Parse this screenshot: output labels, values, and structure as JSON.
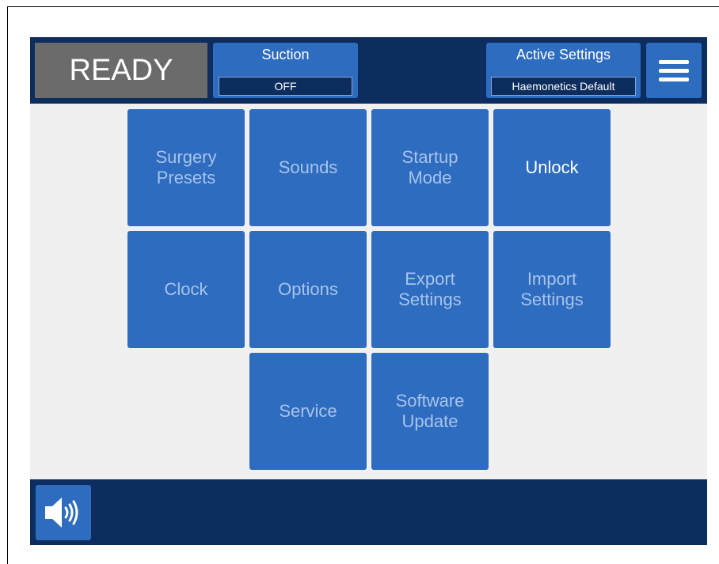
{
  "header": {
    "status": "READY",
    "suction": {
      "title": "Suction",
      "value": "OFF"
    },
    "active_settings": {
      "title": "Active Settings",
      "value": "Haemonetics Default"
    },
    "menu_icon": "hamburger-menu-icon"
  },
  "tiles": [
    {
      "label": "Surgery\nPresets",
      "enabled": false
    },
    {
      "label": "Sounds",
      "enabled": false
    },
    {
      "label": "Startup\nMode",
      "enabled": false
    },
    {
      "label": "Unlock",
      "enabled": true
    },
    {
      "label": "Clock",
      "enabled": false
    },
    {
      "label": "Options",
      "enabled": false
    },
    {
      "label": "Export\nSettings",
      "enabled": false
    },
    {
      "label": "Import\nSettings",
      "enabled": false
    },
    {
      "label": "Service",
      "enabled": false
    },
    {
      "label": "Software\nUpdate",
      "enabled": false
    }
  ],
  "footer": {
    "sound_icon": "speaker-volume-icon"
  },
  "colors": {
    "navy": "#0d2d5e",
    "tile_blue": "#2d6cbf",
    "disabled_text": "#a9c3ea",
    "status_gray": "#6b6b6b",
    "background": "#f0f0f0"
  }
}
